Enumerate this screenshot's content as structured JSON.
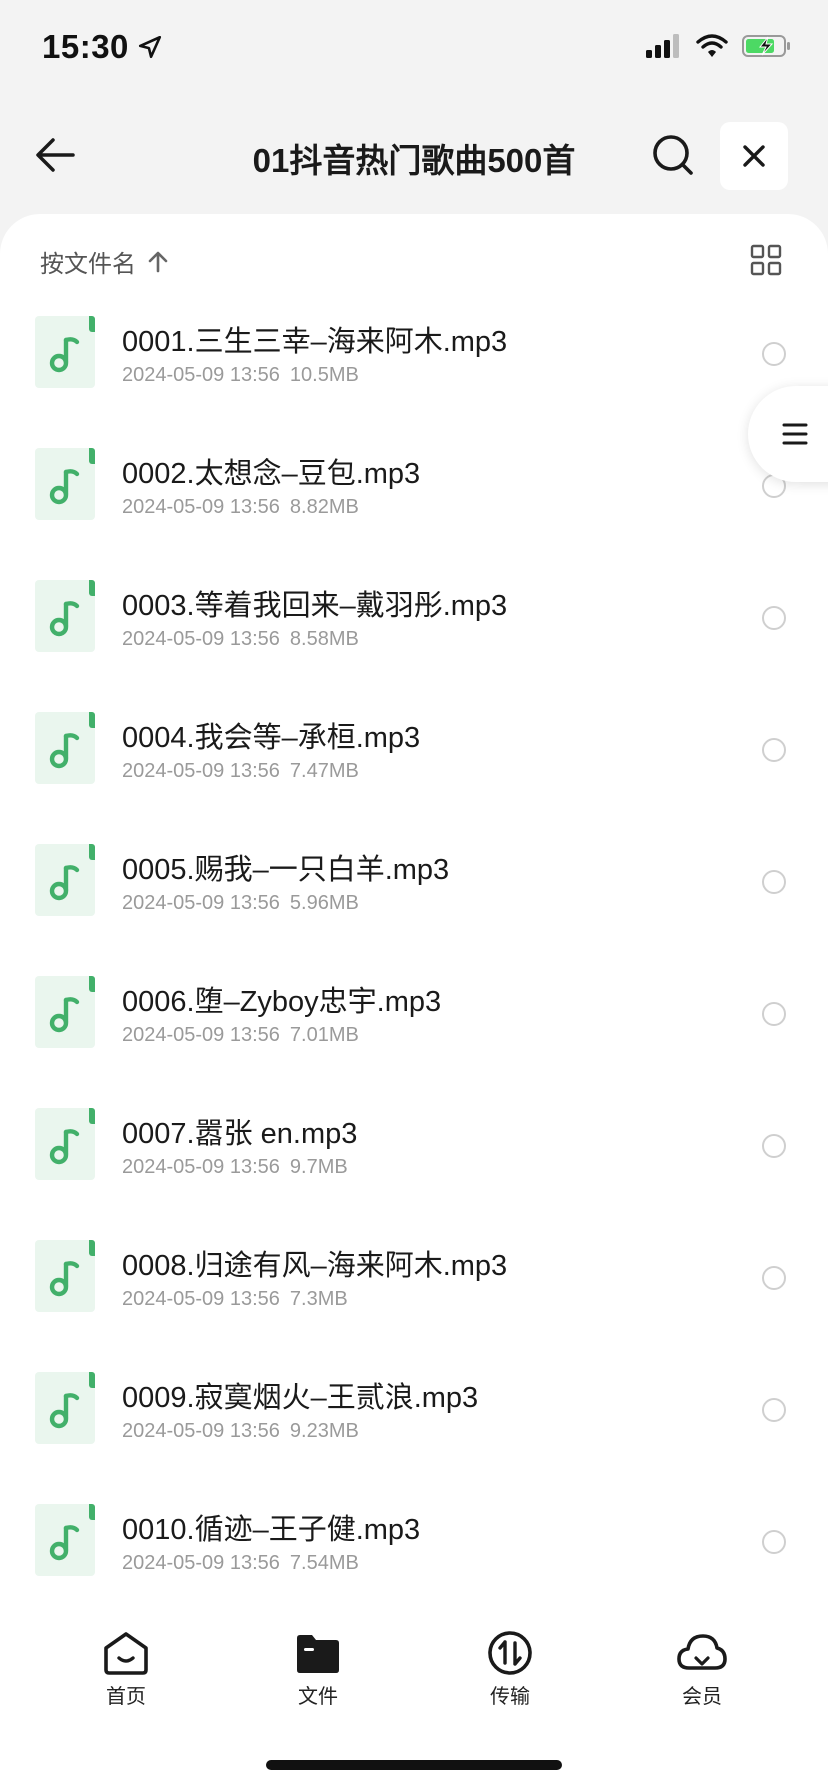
{
  "status": {
    "time": "15:30"
  },
  "header": {
    "title": "01抖音热门歌曲500首"
  },
  "sort": {
    "label": "按文件名"
  },
  "files": [
    {
      "name": "0001.三生三幸–海来阿木.mp3",
      "date": "2024-05-09 13:56",
      "size": "10.5MB"
    },
    {
      "name": "0002.太想念–豆包.mp3",
      "date": "2024-05-09 13:56",
      "size": "8.82MB"
    },
    {
      "name": "0003.等着我回来–戴羽彤.mp3",
      "date": "2024-05-09 13:56",
      "size": "8.58MB"
    },
    {
      "name": "0004.我会等–承桓.mp3",
      "date": "2024-05-09 13:56",
      "size": "7.47MB"
    },
    {
      "name": "0005.赐我–一只白羊.mp3",
      "date": "2024-05-09 13:56",
      "size": "5.96MB"
    },
    {
      "name": "0006.堕–Zyboy忠宇.mp3",
      "date": "2024-05-09 13:56",
      "size": "7.01MB"
    },
    {
      "name": "0007.嚣张 en.mp3",
      "date": "2024-05-09 13:56",
      "size": "9.7MB"
    },
    {
      "name": "0008.归途有风–海来阿木.mp3",
      "date": "2024-05-09 13:56",
      "size": "7.3MB"
    },
    {
      "name": "0009.寂寞烟火–王贰浪.mp3",
      "date": "2024-05-09 13:56",
      "size": "9.23MB"
    },
    {
      "name": "0010.循迹–王子健.mp3",
      "date": "2024-05-09 13:56",
      "size": "7.54MB"
    }
  ],
  "tabs": [
    {
      "label": "首页",
      "icon": "home-icon"
    },
    {
      "label": "文件",
      "icon": "folder-icon"
    },
    {
      "label": "传输",
      "icon": "transfer-icon"
    },
    {
      "label": "会员",
      "icon": "cloud-icon"
    }
  ],
  "colors": {
    "accent": "#42b06a",
    "battery": "#4cd964"
  }
}
